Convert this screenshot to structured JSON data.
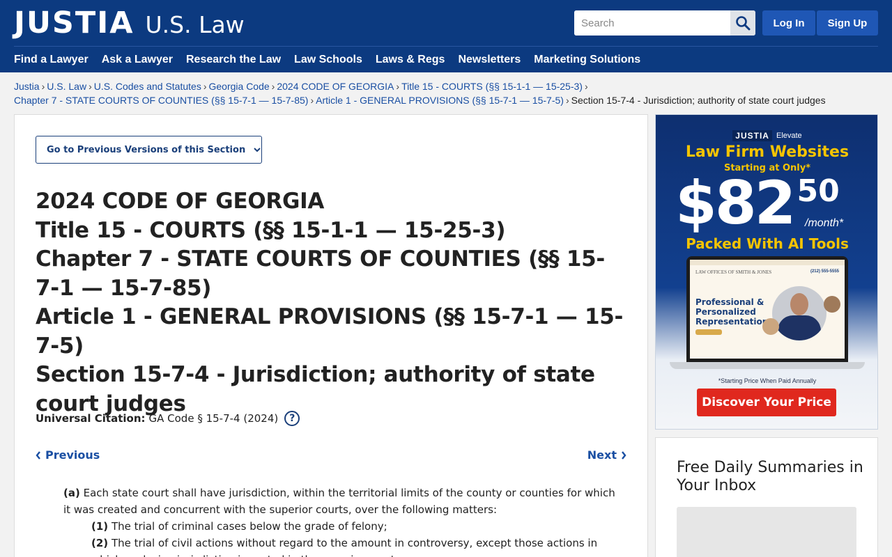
{
  "header": {
    "logo_main": "JUSTIA",
    "logo_sub": "U.S. Law",
    "search_placeholder": "Search",
    "login": "Log In",
    "signup": "Sign Up",
    "brand_color": "#0c3a80"
  },
  "nav": {
    "items": [
      "Find a Lawyer",
      "Ask a Lawyer",
      "Research the Law",
      "Law Schools",
      "Laws & Regs",
      "Newsletters",
      "Marketing Solutions"
    ]
  },
  "breadcrumb": {
    "items": [
      "Justia",
      "U.S. Law",
      "U.S. Codes and Statutes",
      "Georgia Code",
      "2024 CODE OF GEORGIA",
      "Title 15 - COURTS (§§ 15-1-1 — 15-25-3)",
      "Chapter 7 - STATE COURTS OF COUNTIES (§§ 15-7-1 — 15-7-85)",
      "Article 1 - GENERAL PROVISIONS (§§ 15-7-1 — 15-7-5)",
      "Section 15-7-4 - Jurisdiction; authority of state court judges"
    ]
  },
  "main": {
    "prev_versions": "Go to Previous Versions of this Section",
    "title_lines": [
      "2024 CODE OF GEORGIA",
      "Title 15 - COURTS (§§ 15-1-1 — 15-25-3)",
      "Chapter 7 - STATE COURTS OF COUNTIES (§§ 15-7-1 — 15-7-85)",
      "Article 1 - GENERAL PROVISIONS (§§ 15-7-1 — 15-7-5)",
      "Section 15-7-4 - Jurisdiction; authority of state court judges"
    ],
    "citation_label": "Universal Citation:",
    "citation_value": "GA Code § 15-7-4 (2024)",
    "previous": "Previous",
    "next": "Next",
    "law": {
      "a_label": "(a)",
      "a_text": "Each state court shall have jurisdiction, within the territorial limits of the county or counties for which it was created and concurrent with the superior courts, over the following matters:",
      "item1_label": "(1)",
      "item1_text": "The trial of criminal cases below the grade of felony;",
      "item2_label": "(2)",
      "item2_text": "The trial of civil actions without regard to the amount in controversy, except those actions in which exclusive jurisdiction is vested in the superior courts;"
    }
  },
  "ad": {
    "brand": "JUSTIA",
    "brand_sub": "Elevate",
    "headline": "Law Firm Websites",
    "starting": "Starting at Only*",
    "price_dollars": "$82",
    "price_cents": "50",
    "per_month": "/month*",
    "ai": "Packed With AI Tools",
    "screen_firm": "LAW OFFICES OF SMITH & JONES",
    "screen_phone": "(212) 555-5555",
    "screen_tagline": "Professional & Personalized Representation",
    "fine_print": "*Starting Price When Paid Annually",
    "cta": "Discover Your Price",
    "accent_color": "#f5c400",
    "cta_color": "#e0281e"
  },
  "newsletter": {
    "title": "Free Daily Summaries in Your Inbox"
  }
}
